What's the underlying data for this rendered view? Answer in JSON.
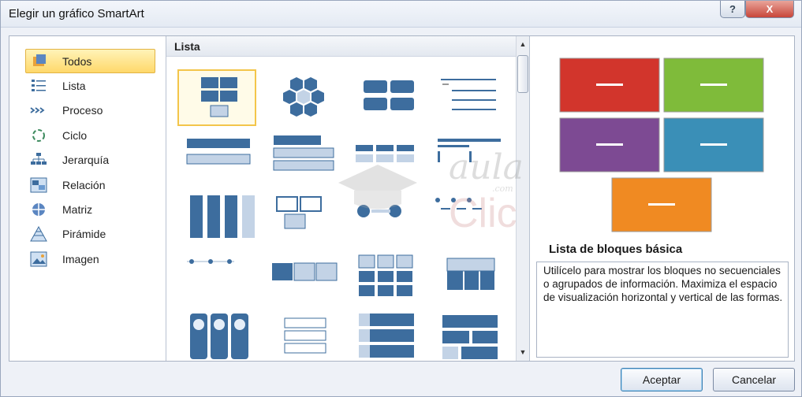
{
  "window": {
    "title": "Elegir un gráfico SmartArt",
    "help_glyph": "?",
    "close_glyph": "X"
  },
  "categories": [
    {
      "label": "Todos",
      "icon": "all-icon",
      "selected": true
    },
    {
      "label": "Lista",
      "icon": "list-icon"
    },
    {
      "label": "Proceso",
      "icon": "process-icon"
    },
    {
      "label": "Ciclo",
      "icon": "cycle-icon"
    },
    {
      "label": "Jerarquía",
      "icon": "hierarchy-icon"
    },
    {
      "label": "Relación",
      "icon": "relationship-icon"
    },
    {
      "label": "Matriz",
      "icon": "matrix-icon"
    },
    {
      "label": "Pirámide",
      "icon": "pyramid-icon"
    },
    {
      "label": "Imagen",
      "icon": "picture-icon"
    }
  ],
  "gallery": {
    "header": "Lista",
    "selected_index": 0
  },
  "watermark": {
    "line1": "aula",
    "line2": "Clic",
    "small": ".com"
  },
  "preview": {
    "name": "Lista de bloques básica",
    "description": "Utilícelo para mostrar los bloques no secuenciales o agrupados de información. Maximiza el espacio de visualización horizontal y vertical de las formas.",
    "block_colors": [
      "#d2352c",
      "#7fbb3a",
      "#7d4a93",
      "#3a8fb7",
      "#f08a22"
    ]
  },
  "buttons": {
    "ok": "Aceptar",
    "cancel": "Cancelar"
  },
  "colors": {
    "accent": "#f3c54a",
    "diagram": "#3d6d9e",
    "diagram_light": "#c3d3e6"
  }
}
